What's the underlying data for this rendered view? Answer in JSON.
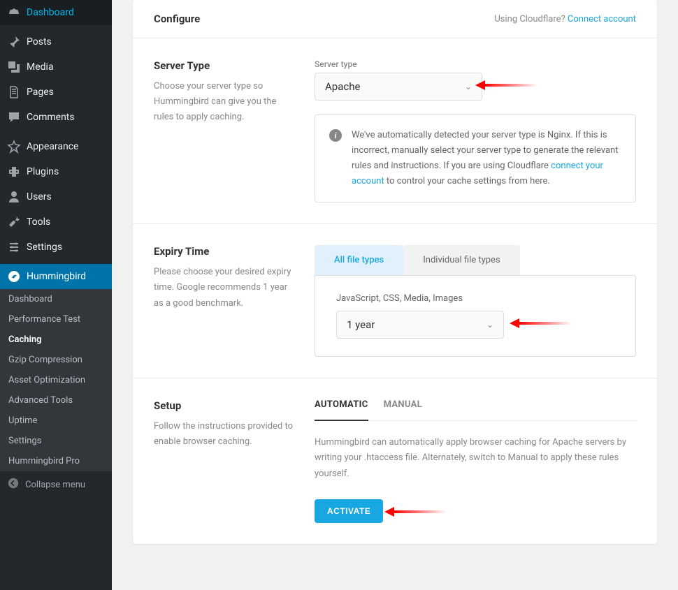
{
  "sidebar": {
    "items": [
      {
        "label": "Dashboard",
        "icon": "dashboard"
      },
      {
        "label": "Posts",
        "icon": "pin"
      },
      {
        "label": "Media",
        "icon": "media"
      },
      {
        "label": "Pages",
        "icon": "pages"
      },
      {
        "label": "Comments",
        "icon": "comments"
      },
      {
        "label": "Appearance",
        "icon": "appearance"
      },
      {
        "label": "Plugins",
        "icon": "plugins"
      },
      {
        "label": "Users",
        "icon": "users"
      },
      {
        "label": "Tools",
        "icon": "tools"
      },
      {
        "label": "Settings",
        "icon": "settings"
      },
      {
        "label": "Hummingbird",
        "icon": "hummingbird",
        "active": true
      }
    ],
    "submenu": [
      {
        "label": "Dashboard"
      },
      {
        "label": "Performance Test"
      },
      {
        "label": "Caching",
        "active": true
      },
      {
        "label": "Gzip Compression"
      },
      {
        "label": "Asset Optimization"
      },
      {
        "label": "Advanced Tools"
      },
      {
        "label": "Uptime"
      },
      {
        "label": "Settings"
      },
      {
        "label": "Hummingbird Pro"
      }
    ],
    "collapse_label": "Collapse menu"
  },
  "card": {
    "title": "Configure",
    "cloudflare_prefix": "Using Cloudflare? ",
    "cloudflare_link": "Connect account"
  },
  "server_section": {
    "title": "Server Type",
    "desc": "Choose your server type so Hummingbird can give you the rules to apply caching.",
    "field_label": "Server type",
    "selected": "Apache",
    "notice_prefix": "We've automatically detected your server type is Nginx. If this is incorrect, manually select your server type to generate the relevant rules and instructions. If you are using Cloudflare ",
    "notice_link": "connect your account",
    "notice_suffix": " to control your cache settings from here."
  },
  "expiry_section": {
    "title": "Expiry Time",
    "desc": "Please choose your desired expiry time. Google recommends 1 year as a good benchmark.",
    "tabs": [
      "All file types",
      "Individual file types"
    ],
    "field_label": "JavaScript, CSS, Media, Images",
    "selected": "1 year"
  },
  "setup_section": {
    "title": "Setup",
    "desc": "Follow the instructions provided to enable browser caching.",
    "tabs": [
      "AUTOMATIC",
      "MANUAL"
    ],
    "body": "Hummingbird can automatically apply browser caching for Apache servers by writing your .htaccess file. Alternately, switch to Manual to apply these rules yourself.",
    "button": "ACTIVATE"
  }
}
